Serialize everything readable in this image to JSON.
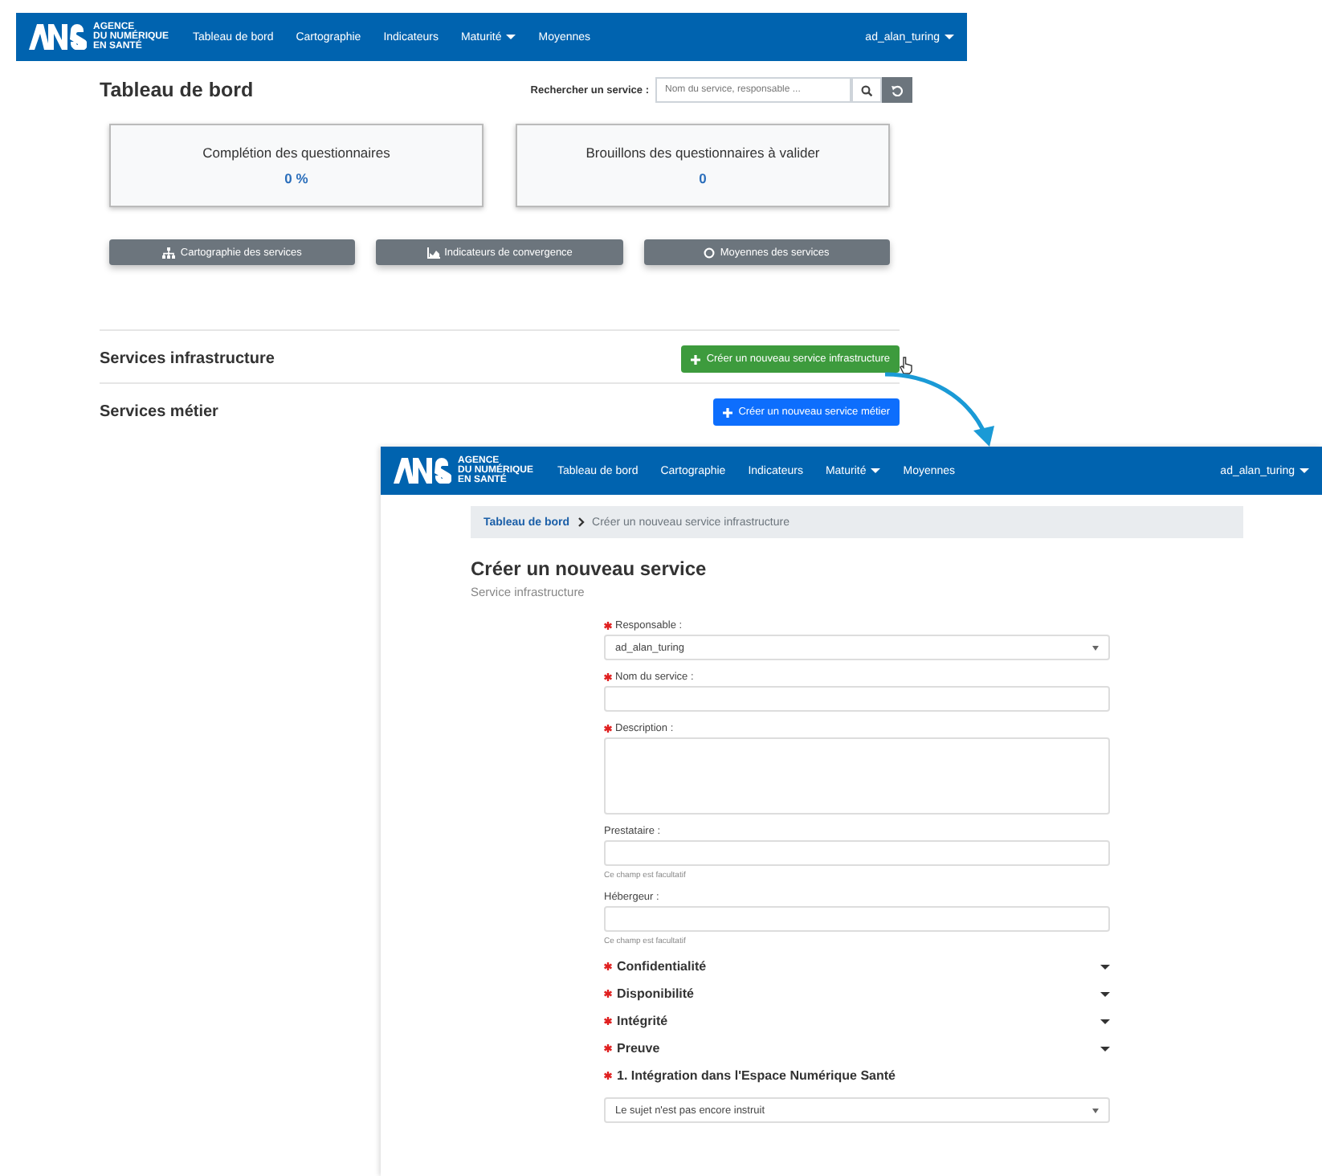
{
  "dashboard_window": {
    "header": {
      "brand": [
        "AGENCE",
        "DU NUMÉRIQUE",
        "EN SANTÉ"
      ],
      "nav": [
        {
          "label": "Tableau de bord",
          "dropdown": false
        },
        {
          "label": "Cartographie",
          "dropdown": false
        },
        {
          "label": "Indicateurs",
          "dropdown": false
        },
        {
          "label": "Maturité",
          "dropdown": true
        },
        {
          "label": "Moyennes",
          "dropdown": false
        }
      ],
      "user": "ad_alan_turing"
    },
    "title": "Tableau de bord",
    "search": {
      "label": "Rechercher un service :",
      "placeholder": "Nom du service, responsable ..."
    },
    "stat_cards": [
      {
        "title": "Complétion des questionnaires",
        "value": "0 %"
      },
      {
        "title": "Brouillons des questionnaires à valider",
        "value": "0"
      }
    ],
    "buttons": [
      {
        "label": "Cartographie des services"
      },
      {
        "label": "Indicateurs de convergence"
      },
      {
        "label": "Moyennes des services"
      }
    ],
    "sections": [
      {
        "title": "Services infrastructure",
        "buttons": [
          {
            "label": "Créer un nouveau service infrastructure",
            "kind": "success",
            "hovered": true
          }
        ]
      },
      {
        "title": "Services métier",
        "buttons": [
          {
            "label": "Créer un nouveau service métier",
            "kind": "primary",
            "hovered": false
          }
        ]
      }
    ]
  },
  "form_window": {
    "header": {
      "brand": [
        "AGENCE",
        "DU NUMÉRIQUE",
        "EN SANTÉ"
      ],
      "nav": [
        {
          "label": "Tableau de bord",
          "dropdown": false
        },
        {
          "label": "Cartographie",
          "dropdown": false
        },
        {
          "label": "Indicateurs",
          "dropdown": false
        },
        {
          "label": "Maturité",
          "dropdown": true
        },
        {
          "label": "Moyennes",
          "dropdown": false
        }
      ],
      "user": "ad_alan_turing"
    },
    "breadcrumb": [
      {
        "label": "Tableau de bord",
        "link": true
      },
      {
        "label": "Créer un nouveau service infrastructure",
        "link": false
      }
    ],
    "title": "Créer un nouveau service",
    "subtitle": "Service infrastructure",
    "fields": [
      {
        "kind": "select",
        "label": "Responsable :",
        "required": true,
        "value": "ad_alan_turing"
      },
      {
        "kind": "input",
        "label": "Nom du service :",
        "required": true
      },
      {
        "kind": "textarea",
        "label": "Description :",
        "required": true
      },
      {
        "kind": "input",
        "label": "Prestataire :",
        "required": false,
        "help": "Ce champ est facultatif"
      },
      {
        "kind": "input",
        "label": "Hébergeur :",
        "required": false,
        "help": "Ce champ est facultatif"
      }
    ],
    "sections": [
      {
        "label": "Confidentialité",
        "required": true,
        "expanded": false
      },
      {
        "label": "Disponibilité",
        "required": true,
        "expanded": false
      },
      {
        "label": "Intégrité",
        "required": true,
        "expanded": false
      },
      {
        "label": "Preuve",
        "required": true,
        "expanded": false
      }
    ],
    "question": {
      "label": "1. Intégration dans l'Espace Numérique Santé",
      "required": true,
      "value": "Le sujet n'est pas encore instruit"
    }
  }
}
